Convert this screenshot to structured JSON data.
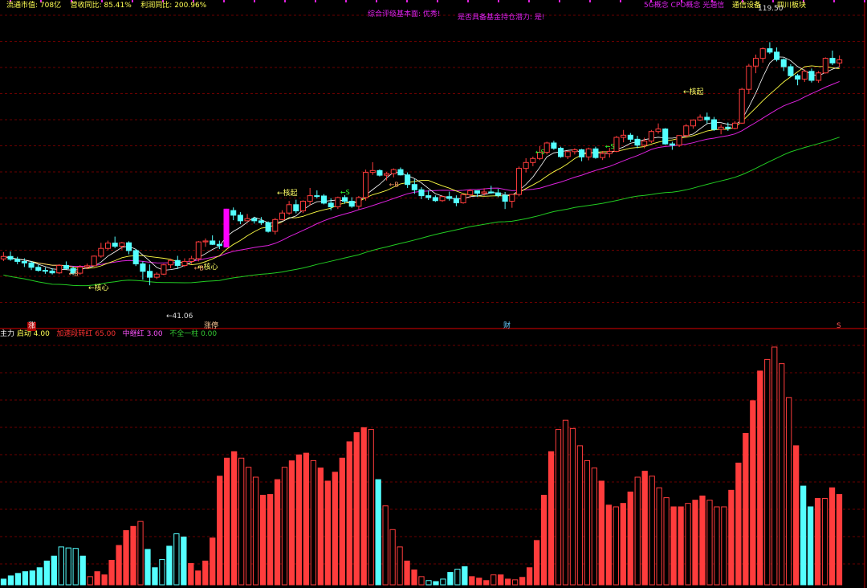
{
  "header": {
    "items": [
      {
        "label": "流通市值:",
        "value": "708亿"
      },
      {
        "label": "营收同比:",
        "value": "85.41%"
      },
      {
        "label": "利润同比:",
        "value": "200.96%"
      }
    ],
    "note1": "综合评级基本面: 优秀!",
    "note2": "是否具备基金持仓潜力: 是!",
    "concepts": "5G概念 CPO概念 光通信",
    "industry": "通信设备",
    "region": "四川板块"
  },
  "main_annotations": {
    "high_label": "119.50",
    "low_label": "←41.06",
    "launch_labels": [
      "←核心",
      "←核心",
      "←核起",
      "←核起"
    ]
  },
  "event_markers": [
    "涨",
    "涨停",
    "财",
    "S"
  ],
  "sub_header": {
    "title": "主力",
    "items": [
      {
        "label": "启动",
        "value": "4.00",
        "color": "#ffff55"
      },
      {
        "label": "加速段转红",
        "value": "65.00",
        "color": "#ff3333"
      },
      {
        "label": "中继红",
        "value": "3.00",
        "color": "#ff55ff"
      },
      {
        "label": "不全一柱",
        "value": "0.00",
        "color": "#33cc33"
      }
    ]
  },
  "colors": {
    "up": "#ff3c3c",
    "down": "#54ffff",
    "ma5": "#ffffff",
    "ma10": "#ffff44",
    "ma20": "#dd22dd",
    "ma60": "#22cc22",
    "grid": "#6a0000",
    "divider": "#b00000",
    "note": "#dd22ee",
    "label": "#ffff66",
    "markerS": "#33ff33",
    "markerB": "#ff9966"
  },
  "chart_data": [
    {
      "type": "candlestick",
      "title": "",
      "price_range": [
        30,
        130
      ],
      "high_value": 119.5,
      "low_value": 41.06,
      "candles_ohlc": [
        [
          49.6,
          51.8,
          48.9,
          50.4
        ],
        [
          50.4,
          52.0,
          49.0,
          49.5
        ],
        [
          49.5,
          50.3,
          47.9,
          48.8
        ],
        [
          48.8,
          49.8,
          47.0,
          48.3
        ],
        [
          48.3,
          48.9,
          46.0,
          46.9
        ],
        [
          46.9,
          47.7,
          45.5,
          45.9
        ],
        [
          45.9,
          46.9,
          44.8,
          45.7
        ],
        [
          45.7,
          46.6,
          44.6,
          45.1
        ],
        [
          45.1,
          47.9,
          44.7,
          47.5
        ],
        [
          47.5,
          48.8,
          46.2,
          46.5
        ],
        [
          46.5,
          47.2,
          44.4,
          45.0
        ],
        [
          45.0,
          47.6,
          44.5,
          47.0
        ],
        [
          47.0,
          48.1,
          46.3,
          47.4
        ],
        [
          47.4,
          50.7,
          47.2,
          50.5
        ],
        [
          50.5,
          54.8,
          50.0,
          53.0
        ],
        [
          53.0,
          55.5,
          52.4,
          54.7
        ],
        [
          54.7,
          56.8,
          53.1,
          53.7
        ],
        [
          53.7,
          55.1,
          52.6,
          54.8
        ],
        [
          54.8,
          55.3,
          51.1,
          52.3
        ],
        [
          52.3,
          52.8,
          47.3,
          48.0
        ],
        [
          48.0,
          48.8,
          42.9,
          45.6
        ],
        [
          45.6,
          47.8,
          41.1,
          43.7
        ],
        [
          43.7,
          45.3,
          43.1,
          44.7
        ],
        [
          44.7,
          48.0,
          44.4,
          47.7
        ],
        [
          47.7,
          49.7,
          46.6,
          49.1
        ],
        [
          49.1,
          50.6,
          46.4,
          47.5
        ],
        [
          47.5,
          49.8,
          47.0,
          48.8
        ],
        [
          48.8,
          50.6,
          48.0,
          49.7
        ],
        [
          49.7,
          55.4,
          48.8,
          55.1
        ],
        [
          55.1,
          56.2,
          53.5,
          55.4
        ],
        [
          55.4,
          57.2,
          54.1,
          54.3
        ],
        [
          54.3,
          55.5,
          52.8,
          53.9
        ],
        [
          53.9,
          65.8,
          53.3,
          65.2
        ],
        [
          65.2,
          66.2,
          62.1,
          63.7
        ],
        [
          63.7,
          64.7,
          60.8,
          61.9
        ],
        [
          61.9,
          64.1,
          61.8,
          62.6
        ],
        [
          62.6,
          63.2,
          61.0,
          61.9
        ],
        [
          61.9,
          63.1,
          60.6,
          61.3
        ],
        [
          61.3,
          61.7,
          58.1,
          58.5
        ],
        [
          58.5,
          62.8,
          57.5,
          62.3
        ],
        [
          62.3,
          65.3,
          62.0,
          64.4
        ],
        [
          64.4,
          68.3,
          63.8,
          67.1
        ],
        [
          67.1,
          68.7,
          64.3,
          65.1
        ],
        [
          65.1,
          68.5,
          64.4,
          68.2
        ],
        [
          68.2,
          72.5,
          66.9,
          70.0
        ],
        [
          70.0,
          71.7,
          69.1,
          69.9
        ],
        [
          69.9,
          70.5,
          67.2,
          67.6
        ],
        [
          67.6,
          69.2,
          65.3,
          66.4
        ],
        [
          66.4,
          69.7,
          65.7,
          69.4
        ],
        [
          69.4,
          70.2,
          67.4,
          68.2
        ],
        [
          68.2,
          69.5,
          66.1,
          66.6
        ],
        [
          66.6,
          69.9,
          65.6,
          69.4
        ],
        [
          69.4,
          78.4,
          68.4,
          77.5
        ],
        [
          77.5,
          80.8,
          76.7,
          78.1
        ],
        [
          78.1,
          78.5,
          76.2,
          76.6
        ],
        [
          76.6,
          77.6,
          74.9,
          77.1
        ],
        [
          77.1,
          78.8,
          75.9,
          78.4
        ],
        [
          78.4,
          79.1,
          76.5,
          76.7
        ],
        [
          76.7,
          77.5,
          72.5,
          73.6
        ],
        [
          73.6,
          75.4,
          70.6,
          71.9
        ],
        [
          71.9,
          72.7,
          68.9,
          70.0
        ],
        [
          70.0,
          71.7,
          68.6,
          69.4
        ],
        [
          69.4,
          70.1,
          68.0,
          68.4
        ],
        [
          68.4,
          70.0,
          68.0,
          69.7
        ],
        [
          69.7,
          71.3,
          68.4,
          69.1
        ],
        [
          69.1,
          70.1,
          66.6,
          67.7
        ],
        [
          67.7,
          70.5,
          67.4,
          70.3
        ],
        [
          70.3,
          72.1,
          69.3,
          71.6
        ],
        [
          71.6,
          71.7,
          69.6,
          70.8
        ],
        [
          70.8,
          72.4,
          70.0,
          71.2
        ],
        [
          71.2,
          73.2,
          70.6,
          70.9
        ],
        [
          70.9,
          72.2,
          69.5,
          70.1
        ],
        [
          70.1,
          71.2,
          65.7,
          68.2
        ],
        [
          68.2,
          70.6,
          66.1,
          70.4
        ],
        [
          70.4,
          79.4,
          69.8,
          78.8
        ],
        [
          78.8,
          82.1,
          77.5,
          80.7
        ],
        [
          80.7,
          82.6,
          79.5,
          82.0
        ],
        [
          82.0,
          86.0,
          81.5,
          84.0
        ],
        [
          84.0,
          87.4,
          83.3,
          87.0
        ],
        [
          87.0,
          87.7,
          84.8,
          85.3
        ],
        [
          85.3,
          85.8,
          82.2,
          82.6
        ],
        [
          82.6,
          84.5,
          81.8,
          84.2
        ],
        [
          84.2,
          85.3,
          83.3,
          84.8
        ],
        [
          84.8,
          85.1,
          81.1,
          82.5
        ],
        [
          82.5,
          85.5,
          81.4,
          85.1
        ],
        [
          85.1,
          85.8,
          81.9,
          82.3
        ],
        [
          82.3,
          84.4,
          81.5,
          83.6
        ],
        [
          83.6,
          85.4,
          82.3,
          84.3
        ],
        [
          84.3,
          89.3,
          84.0,
          88.8
        ],
        [
          88.8,
          91.2,
          87.2,
          89.5
        ],
        [
          89.5,
          90.2,
          87.3,
          88.2
        ],
        [
          88.2,
          89.3,
          85.3,
          86.3
        ],
        [
          86.3,
          88.7,
          85.3,
          87.6
        ],
        [
          87.6,
          91.2,
          87.0,
          90.7
        ],
        [
          90.7,
          93.3,
          90.0,
          91.5
        ],
        [
          91.5,
          91.8,
          86.4,
          86.7
        ],
        [
          86.7,
          87.4,
          84.8,
          86.3
        ],
        [
          86.3,
          89.5,
          85.7,
          89.4
        ],
        [
          89.4,
          93.1,
          88.7,
          92.5
        ],
        [
          92.5,
          94.6,
          91.6,
          94.4
        ],
        [
          94.4,
          96.2,
          94.1,
          95.3
        ],
        [
          95.3,
          96.8,
          93.3,
          94.5
        ],
        [
          94.5,
          95.4,
          90.9,
          91.4
        ],
        [
          91.4,
          93.0,
          89.8,
          92.1
        ],
        [
          92.1,
          93.6,
          90.9,
          91.7
        ],
        [
          91.7,
          94.0,
          91.4,
          93.4
        ],
        [
          93.4,
          104.8,
          93.2,
          104.3
        ],
        [
          104.3,
          112.5,
          102.8,
          111.8
        ],
        [
          111.8,
          115.5,
          109.5,
          114.3
        ],
        [
          114.3,
          117.8,
          112.9,
          117.4
        ],
        [
          117.4,
          119.5,
          115.7,
          116.3
        ],
        [
          116.3,
          117.8,
          113.3,
          113.9
        ],
        [
          113.9,
          114.3,
          110.2,
          111.6
        ],
        [
          111.6,
          112.4,
          108.4,
          108.7
        ],
        [
          108.7,
          109.3,
          105.6,
          107.6
        ],
        [
          107.6,
          110.7,
          106.7,
          110.1
        ],
        [
          110.1,
          111.0,
          106.5,
          107.2
        ],
        [
          107.2,
          110.2,
          106.4,
          109.6
        ],
        [
          109.6,
          114.6,
          109.4,
          114.3
        ],
        [
          114.3,
          116.8,
          112.1,
          112.8
        ],
        [
          112.8,
          115.2,
          111.4,
          113.8
        ]
      ]
    },
    {
      "type": "bar",
      "title": "",
      "ylim": [
        0,
        100
      ],
      "values": [
        2.3,
        3.6,
        4.6,
        5.3,
        5.6,
        6.9,
        9.6,
        11.6,
        15.3,
        14.9,
        14.7,
        11.6,
        3.3,
        5.3,
        4.0,
        9.9,
        15.9,
        21.9,
        23.6,
        25.6,
        14.3,
        6.9,
        10.2,
        15.6,
        20.6,
        19.3,
        8.6,
        5.6,
        9.6,
        18.9,
        43.9,
        51.2,
        53.8,
        51.2,
        47.5,
        43.5,
        36.2,
        36.5,
        42.5,
        47.5,
        50.1,
        52.5,
        53.2,
        50.2,
        47.2,
        41.9,
        45.5,
        51.2,
        57.8,
        61.5,
        63.5,
        62.8,
        42.5,
        31.9,
        22.3,
        15.3,
        9.6,
        6.0,
        3.3,
        1.7,
        1.3,
        2.3,
        5.0,
        6.3,
        7.3,
        3.3,
        2.7,
        1.7,
        4.0,
        4.0,
        2.3,
        2.0,
        3.0,
        6.9,
        17.9,
        36.2,
        53.8,
        62.8,
        66.5,
        63.2,
        56.2,
        50.2,
        47.2,
        41.9,
        32.2,
        31.5,
        32.9,
        37.5,
        43.5,
        45.9,
        43.9,
        39.2,
        35.2,
        31.5,
        31.5,
        32.9,
        34.2,
        35.9,
        34.2,
        31.5,
        31.5,
        38.2,
        49.2,
        61.2,
        74.4,
        86.4,
        91.1,
        96.1,
        89.4,
        75.7,
        56.2,
        39.9,
        31.5,
        34.9,
        34.9,
        39.2,
        36.5
      ],
      "colors_by_bar": [
        "d",
        "d",
        "d",
        "d",
        "d",
        "d",
        "d",
        "d",
        "d",
        "d",
        "d",
        "d",
        "u",
        "u",
        "u",
        "u",
        "u",
        "u",
        "u",
        "u",
        "d",
        "d",
        "d",
        "d",
        "d",
        "d",
        "u",
        "u",
        "u",
        "u",
        "u",
        "u",
        "u",
        "u",
        "u",
        "u",
        "u",
        "u",
        "u",
        "u",
        "u",
        "u",
        "u",
        "u",
        "u",
        "u",
        "u",
        "u",
        "u",
        "u",
        "u",
        "u",
        "d",
        "u",
        "u",
        "u",
        "u",
        "u",
        "u",
        "d",
        "d",
        "d",
        "d",
        "d",
        "d",
        "u",
        "u",
        "u",
        "u",
        "u",
        "u",
        "u",
        "u",
        "u",
        "u",
        "u",
        "u",
        "u",
        "u",
        "u",
        "u",
        "u",
        "u",
        "u",
        "u",
        "u",
        "u",
        "u",
        "u",
        "u",
        "u",
        "u",
        "u",
        "u",
        "u",
        "u",
        "u",
        "u",
        "u",
        "u",
        "u",
        "u",
        "u",
        "u",
        "u",
        "u",
        "u",
        "u",
        "u",
        "u",
        "u",
        "d",
        "d",
        "u",
        "u",
        "u",
        "u"
      ],
      "hollow_by_bar": [
        false,
        false,
        false,
        false,
        false,
        false,
        false,
        false,
        true,
        true,
        true,
        false,
        true,
        false,
        false,
        false,
        false,
        false,
        false,
        true,
        false,
        false,
        true,
        false,
        true,
        false,
        false,
        false,
        false,
        false,
        false,
        false,
        false,
        true,
        true,
        true,
        false,
        false,
        false,
        true,
        false,
        false,
        false,
        true,
        false,
        false,
        false,
        false,
        false,
        false,
        false,
        true,
        false,
        true,
        true,
        true,
        false,
        false,
        true,
        true,
        false,
        true,
        false,
        true,
        false,
        false,
        false,
        false,
        true,
        false,
        false,
        true,
        false,
        false,
        false,
        false,
        false,
        true,
        true,
        true,
        true,
        true,
        true,
        false,
        false,
        true,
        false,
        false,
        true,
        false,
        true,
        true,
        true,
        false,
        false,
        true,
        false,
        false,
        true,
        true,
        true,
        false,
        false,
        false,
        false,
        false,
        true,
        true,
        true,
        true,
        false,
        false,
        false,
        false,
        true,
        false,
        false
      ]
    }
  ]
}
